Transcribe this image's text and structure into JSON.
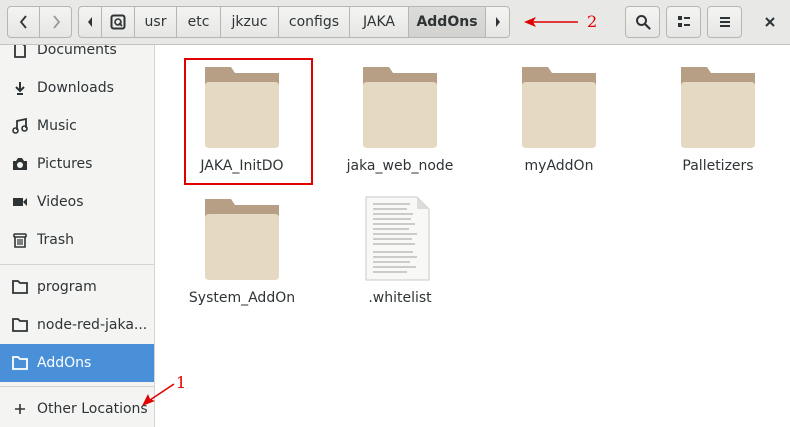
{
  "toolbar": {
    "back_icon": "chevron-left-icon",
    "forward_icon": "chevron-right-icon",
    "search_icon": "search-icon",
    "view_icon": "view-options-icon",
    "menu_icon": "hamburger-menu-icon",
    "close_icon": "close-icon"
  },
  "pathbar": {
    "crumbs": [
      "usr",
      "etc",
      "jkzuc",
      "configs",
      "JAKA",
      "AddOns"
    ]
  },
  "sidebar": {
    "items": [
      {
        "label": "Documents",
        "icon": "document-icon"
      },
      {
        "label": "Downloads",
        "icon": "download-icon"
      },
      {
        "label": "Music",
        "icon": "music-icon"
      },
      {
        "label": "Pictures",
        "icon": "camera-icon"
      },
      {
        "label": "Videos",
        "icon": "video-icon"
      },
      {
        "label": "Trash",
        "icon": "trash-icon"
      },
      {
        "label": "program",
        "icon": "folder-icon"
      },
      {
        "label": "node-red-jaka...",
        "icon": "folder-icon"
      },
      {
        "label": "AddOns",
        "icon": "folder-icon"
      },
      {
        "label": "Other Locations",
        "icon": "plus-icon"
      }
    ]
  },
  "files": [
    {
      "name": "JAKA_InitDO",
      "type": "folder"
    },
    {
      "name": "jaka_web_node",
      "type": "folder"
    },
    {
      "name": "myAddOn",
      "type": "folder"
    },
    {
      "name": "Palletizers",
      "type": "folder"
    },
    {
      "name": "System_AddOn",
      "type": "folder"
    },
    {
      "name": ".whitelist",
      "type": "text-file"
    }
  ],
  "annotations": {
    "label_1": "1",
    "label_2": "2",
    "color": "#e00000"
  }
}
